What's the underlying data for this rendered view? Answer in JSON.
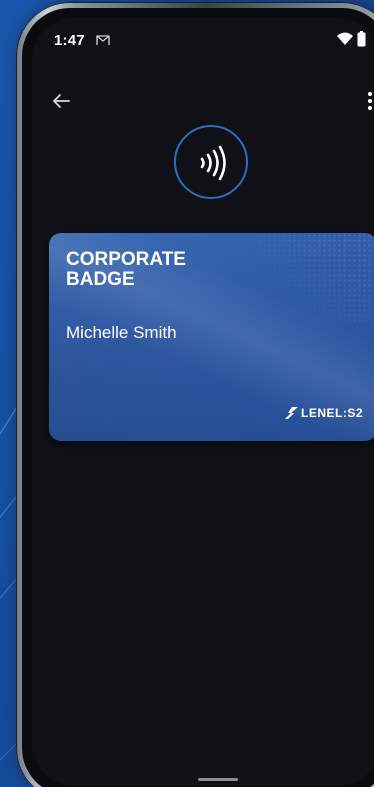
{
  "status_bar": {
    "time": "1:47",
    "notification_icon": "gmail-icon",
    "wifi_icon": "wifi-icon",
    "battery_icon": "battery-icon"
  },
  "app_bar": {
    "back_icon": "arrow-left-icon",
    "menu_icon": "more-vert-icon"
  },
  "nfc": {
    "icon": "contactless-icon",
    "ring_color": "#2c6fc0"
  },
  "badge": {
    "title": "CORPORATE\nBADGE",
    "holder_name": "Michelle Smith",
    "brand": "LENEL:S2",
    "brand_icon": "lenel-logo-icon",
    "card_color": "#3162ad"
  },
  "colors": {
    "background": "#1750a3",
    "screen": "#0f1116",
    "text": "#ffffff"
  }
}
